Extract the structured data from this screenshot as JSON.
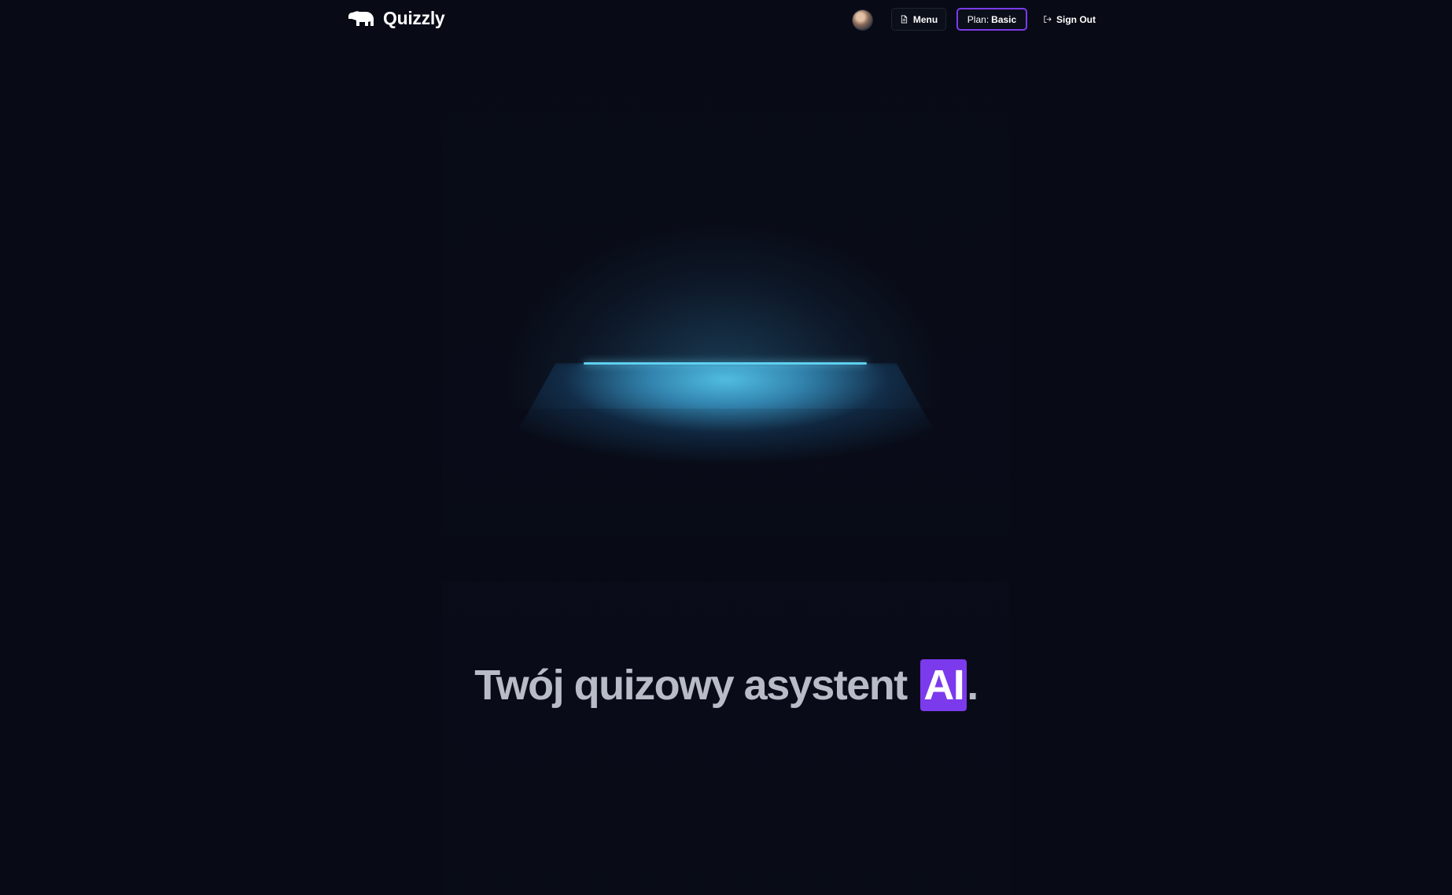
{
  "header": {
    "brand": "Quizzly",
    "logo_icon": "polar-bear-icon",
    "avatar_icon": "user-avatar",
    "menu_label": "Menu",
    "menu_icon": "document-icon",
    "plan_prefix": "Plan:",
    "plan_value": "Basic",
    "signout_label": "Sign Out",
    "signout_icon": "logout-icon"
  },
  "hero": {
    "title_main": "Twój quizowy asystent",
    "title_highlight": "AI",
    "title_end": "."
  },
  "colors": {
    "background": "#080b16",
    "accent": "#7c3aed",
    "lamp": "#5fd0f0",
    "headline": "#b8bcc6"
  }
}
